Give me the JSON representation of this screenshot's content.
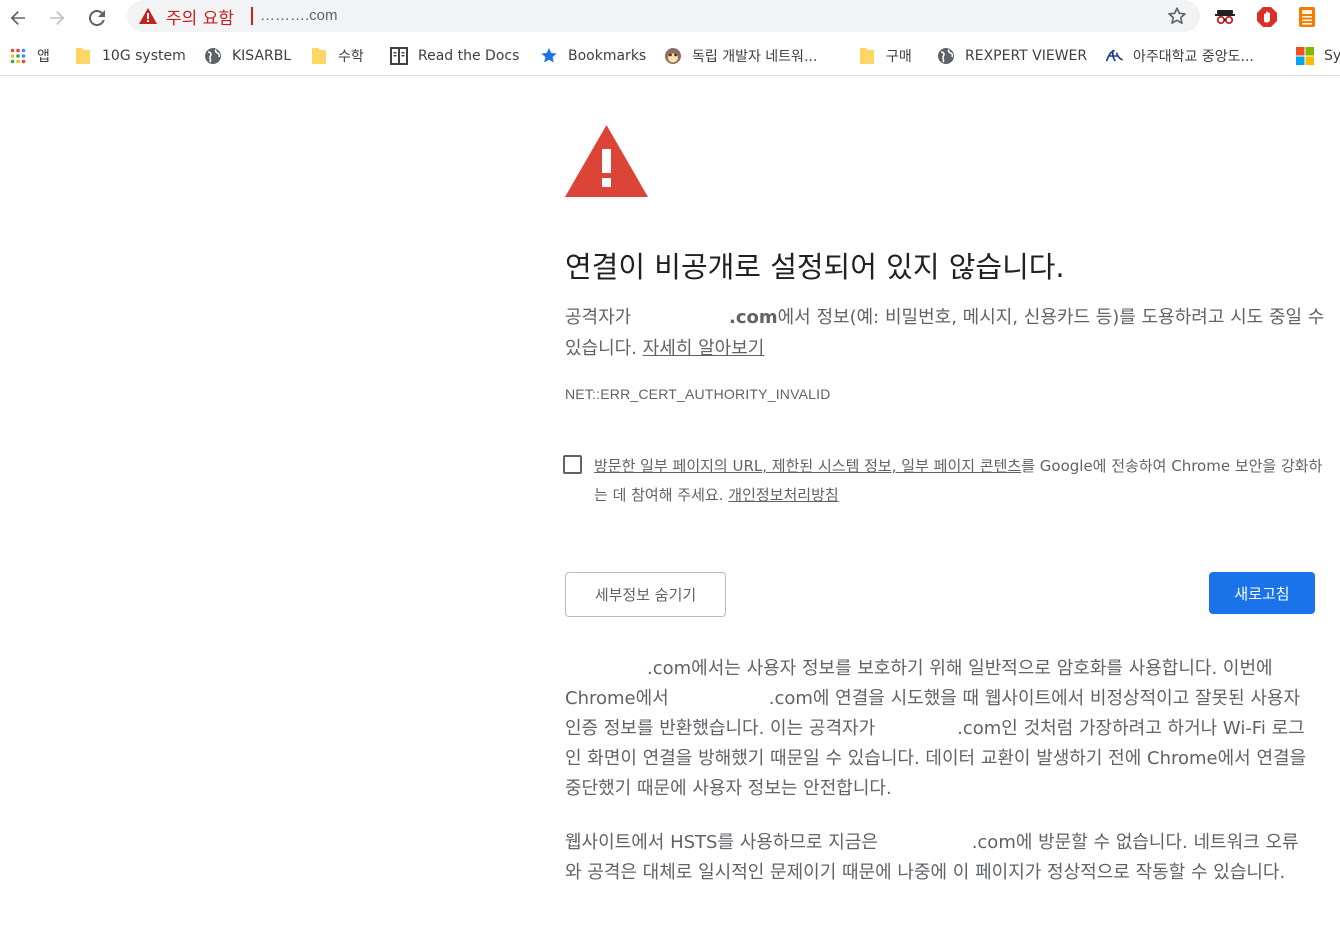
{
  "browser": {
    "omnibox": {
      "security_label": "주의 요함",
      "url": "……….com"
    },
    "bookmarks": [
      {
        "label": "앱",
        "icon": "apps-grid-icon"
      },
      {
        "label": "10G system",
        "icon": "folder-icon"
      },
      {
        "label": "KISARBL",
        "icon": "globe-icon"
      },
      {
        "label": "수학",
        "icon": "folder-icon"
      },
      {
        "label": "Read the Docs",
        "icon": "book-icon"
      },
      {
        "label": "Bookmarks",
        "icon": "star-icon"
      },
      {
        "label": "독립 개발자 네트워...",
        "icon": "monkey-icon"
      },
      {
        "label": "구매",
        "icon": "folder-icon"
      },
      {
        "label": "REXPERT VIEWER",
        "icon": "globe-icon"
      },
      {
        "label": "아주대학교 중앙도...",
        "icon": "ajou-logo-icon"
      },
      {
        "label": "Sy",
        "icon": "microsoft-logo-icon"
      }
    ]
  },
  "interstitial": {
    "heading": "연결이 비공개로 설정되어 있지 않습니다.",
    "intro_prefix": "공격자가",
    "intro_domain": ".com",
    "intro_suffix": "에서 정보(예: 비밀번호, 메시지, 신용카드 등)를 도용하려고 시도 중일 수 있습니다.",
    "learn_more": "자세히 알아보기",
    "error_code": "NET::ERR_CERT_AUTHORITY_INVALID",
    "checkbox_link": "방문한 일부 페이지의 URL, 제한된 시스템 정보, 일부 페이지 콘텐츠",
    "checkbox_text": "를 Google에 전송하여 Chrome 보안을 강화하는 데 참여해 주세요.",
    "privacy_link": "개인정보처리방침",
    "hide_details": "세부정보 숨기기",
    "reload": "새로고침",
    "details_1a": ".com에서는 사용자 정보를 보호하기 위해 일반적으로 암호화를 사용합니다. 이번에 Chrome에서",
    "details_1b": ".com에 연결을 시도했을 때 웹사이트에서 비정상적이고 잘못된 사용자 인증 정보를 반환했습니다. 이는 공격자가",
    "details_1c": ".com인 것처럼 가장하려고 하거나 Wi-Fi 로그인 화면이 연결을 방해했기 때문일 수 있습니다. 데이터 교환이 발생하기 전에 Chrome에서 연결을 중단했기 때문에 사용자 정보는 안전합니다.",
    "details_2a": "웹사이트에서 HSTS를 사용하므로 지금은",
    "details_2b": ".com에 방문할 수 없습니다. 네트워크 오류와 공격은 대체로 일시적인 문제이기 때문에 나중에 이 페이지가 정상적으로 작동할 수 있습니다."
  }
}
